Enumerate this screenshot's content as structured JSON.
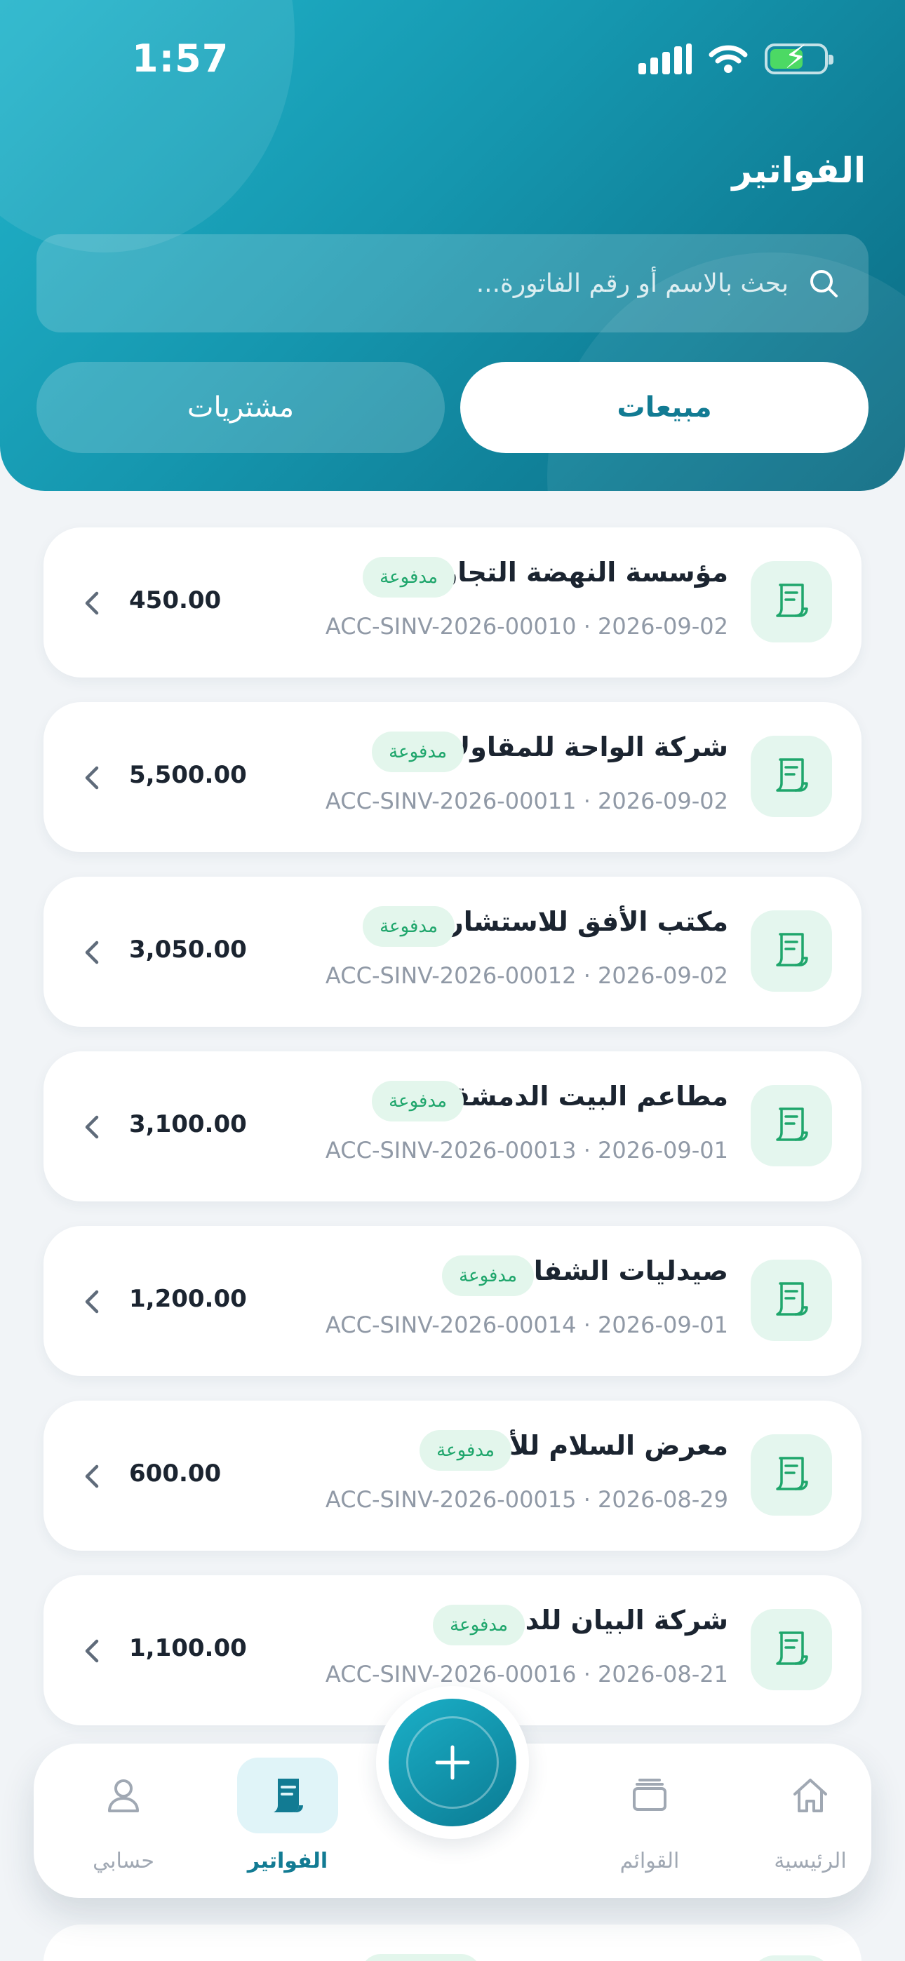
{
  "status": {
    "time": "1:57"
  },
  "header": {
    "title": "الفواتير",
    "search_placeholder": "بحث بالاسم أو رقم الفاتورة...",
    "tabs": {
      "sales": "مبيعات",
      "purchases": "مشتريات"
    }
  },
  "colors": {
    "primary": "#1596ae",
    "paid_badge_bg": "#e3f6ec",
    "paid_badge_text": "#1fa66c"
  },
  "invoices": [
    {
      "name": "مؤسسة النهضة التجارية",
      "status": "مدفوعة",
      "meta": "ACC-SINV-2026-00010 · 2026-09-02",
      "amount": "450.00"
    },
    {
      "name": "شركة الواحة للمقاولات",
      "status": "مدفوعة",
      "meta": "ACC-SINV-2026-00011 · 2026-09-02",
      "amount": "5,500.00"
    },
    {
      "name": "مكتب الأفق للاستشارات",
      "status": "مدفوعة",
      "meta": "ACC-SINV-2026-00012 · 2026-09-02",
      "amount": "3,050.00"
    },
    {
      "name": "مطاعم البيت الدمشقي",
      "status": "مدفوعة",
      "meta": "ACC-SINV-2026-00013 · 2026-09-01",
      "amount": "3,100.00"
    },
    {
      "name": "صيدليات الشفاء",
      "status": "مدفوعة",
      "meta": "ACC-SINV-2026-00014 · 2026-09-01",
      "amount": "1,200.00"
    },
    {
      "name": "معرض السلام للأثاث",
      "status": "مدفوعة",
      "meta": "ACC-SINV-2026-00015 · 2026-08-29",
      "amount": "600.00"
    },
    {
      "name": "شركة البيان للدعاية",
      "status": "مدفوعة",
      "meta": "ACC-SINV-2026-00016 · 2026-08-21",
      "amount": "1,100.00"
    }
  ],
  "nav": {
    "home": "الرئيسية",
    "lists": "القوائم",
    "invoices": "الفواتير",
    "account": "حسابي"
  },
  "icons": [
    "search-icon",
    "receipt-icon",
    "chevron-left-icon",
    "home-icon",
    "layers-icon",
    "plus-icon",
    "invoice-icon",
    "user-icon",
    "signal-icon",
    "wifi-icon",
    "battery-icon"
  ]
}
